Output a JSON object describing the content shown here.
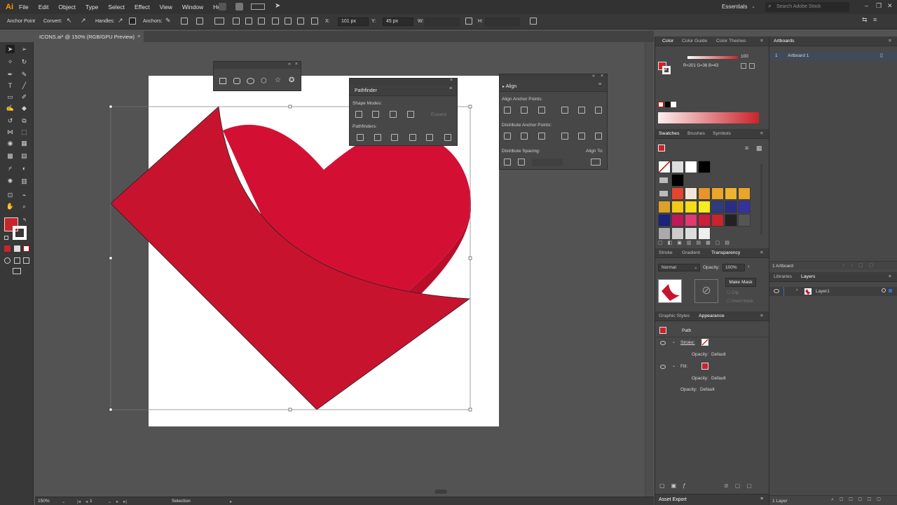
{
  "app": {
    "logo": "Ai"
  },
  "menu": [
    "File",
    "Edit",
    "Object",
    "Type",
    "Select",
    "Effect",
    "View",
    "Window",
    "Help"
  ],
  "workspace": "Essentials",
  "search_placeholder": "Search Adobe Stock",
  "control_bar": {
    "anchor_point": "Anchor Point",
    "convert": "Convert:",
    "handles": "Handles:",
    "anchors": "Anchors:",
    "x_label": "X:",
    "x_value": "101 px",
    "y_label": "Y:",
    "y_value": "45 px",
    "w_label": "W:"
  },
  "document_tab": "ICONS.ai* @ 150% (RGB/GPU Preview)",
  "status": {
    "zoom": "150%",
    "artboard": "1",
    "tool": "Selection"
  },
  "pathfinder": {
    "title": "Pathfinder",
    "shape_modes": "Shape Modes:",
    "expand": "Expand",
    "pathfinders": "Pathfinders:"
  },
  "align": {
    "title": "Align",
    "align_anchor_points": "Align Anchor Points:",
    "distribute_anchor_points": "Distribute Anchor Points:",
    "distribute_spacing": "Distribute Spacing:",
    "align_to": "Align To:"
  },
  "color_panel": {
    "tabs": [
      "Color",
      "Color Guide",
      "Color Themes"
    ],
    "rgb_readout": "R=201 G=36 B=43",
    "opacity": "100",
    "accent": "#c9242b"
  },
  "swatches_panel": {
    "tabs": [
      "Swatches",
      "Brushes",
      "Symbols"
    ]
  },
  "transparency_panel": {
    "tabs": [
      "Stroke",
      "Gradient",
      "Transparency"
    ],
    "blend_mode": "Normal",
    "opacity_label": "Opacity:",
    "opacity_value": "100%",
    "make_mask": "Make Mask",
    "clip": "Clip",
    "invert_mask": "Invert Mask"
  },
  "appearance_panel": {
    "tabs": [
      "Graphic Styles",
      "Appearance"
    ],
    "object": "Path",
    "rows": [
      {
        "label": "Stroke:",
        "opacity": "Opacity:",
        "opacity_value": "Default"
      },
      {
        "label": "Fill:",
        "opacity": "Opacity:",
        "opacity_value": "Default"
      }
    ],
    "opacity_row": "Opacity:",
    "opacity_row_value": "Default"
  },
  "asset_export": "Asset Export",
  "artboards_panel": {
    "title": "Artboards",
    "items": [
      {
        "index": "1",
        "name": "Artboard 1"
      }
    ],
    "count": "1 Artboard"
  },
  "layers_panel": {
    "tabs": [
      "Libraries",
      "Layers"
    ],
    "layers": [
      "Layer1"
    ],
    "count": "1 Layer"
  },
  "colors": {
    "heart": "#d31034",
    "diamond": "#c8132f",
    "fill": "#c9242b"
  }
}
